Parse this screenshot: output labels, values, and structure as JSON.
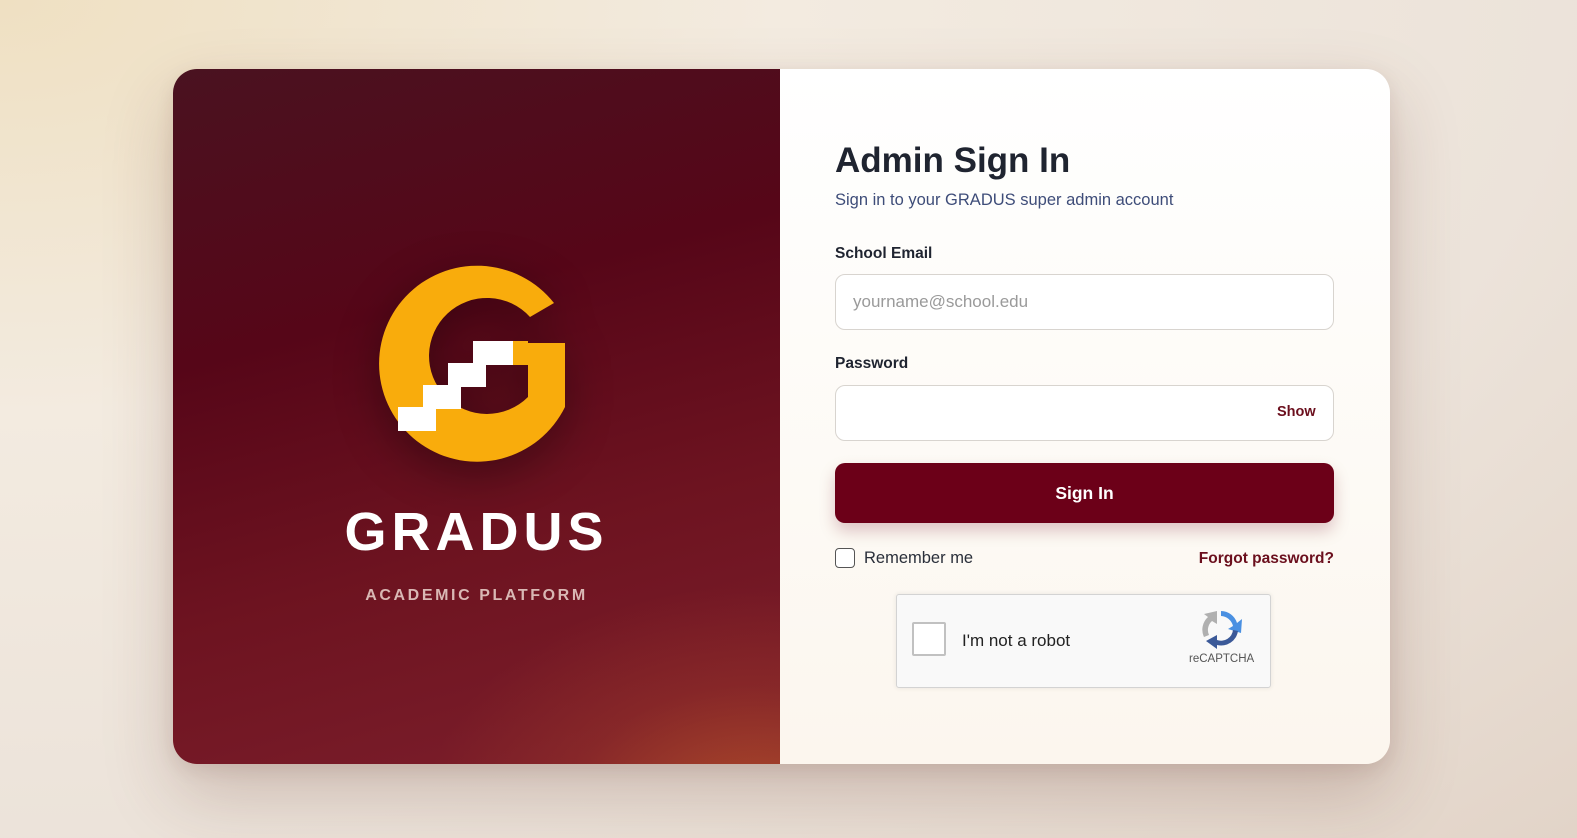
{
  "brand": {
    "name": "GRADUS",
    "tagline": "ACADEMIC PLATFORM",
    "logo_icon": "gradus-stairs-g-logo",
    "colors": {
      "logo": "#f9ac0c",
      "panel": "#560618"
    }
  },
  "form": {
    "title": "Admin Sign In",
    "subtitle": "Sign in to your GRADUS super admin account",
    "email": {
      "label": "School Email",
      "placeholder": "yourname@school.edu",
      "value": ""
    },
    "password": {
      "label": "Password",
      "value": "",
      "show_label": "Show"
    },
    "submit_label": "Sign In",
    "remember_label": "Remember me",
    "remember_checked": false,
    "forgot_label": "Forgot password?",
    "accent_color": "#6c0018"
  },
  "captcha": {
    "label": "I'm not a robot",
    "brand": "reCAPTCHA",
    "checked": false,
    "icon": "recaptcha-icon"
  }
}
